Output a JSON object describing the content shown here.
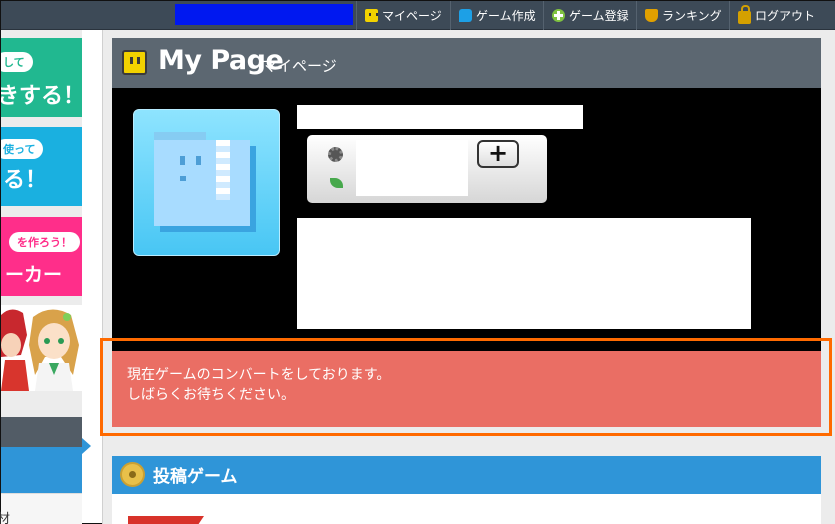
{
  "topnav": {
    "items": [
      {
        "label": "マイページ",
        "icon": "mypage-icon"
      },
      {
        "label": "ゲーム作成",
        "icon": "create-icon"
      },
      {
        "label": "ゲーム登録",
        "icon": "register-icon"
      },
      {
        "label": "ランキング",
        "icon": "trophy-icon"
      },
      {
        "label": "ログアウト",
        "icon": "lock-icon"
      }
    ]
  },
  "sidebar": {
    "banner1": {
      "pill": "して",
      "big": "きする！"
    },
    "banner2": {
      "pill": "使って",
      "big": "る！"
    },
    "banner3": {
      "pill": "を作ろう！",
      "big": "ーカー"
    },
    "item_label": "材"
  },
  "mypage": {
    "title": "My Page",
    "subtitle": "マイページ",
    "plus_label": "+"
  },
  "alert": {
    "line1": "現在ゲームのコンバートをしております。",
    "line2": "しばらくお待ちください。"
  },
  "games": {
    "title": "投稿ゲーム"
  },
  "colors": {
    "topbar": "#3d4a57",
    "header": "#5c6771",
    "alert": "#ea6e64",
    "alert_outline": "#ff6a00",
    "section_blue": "#2f95d8"
  }
}
